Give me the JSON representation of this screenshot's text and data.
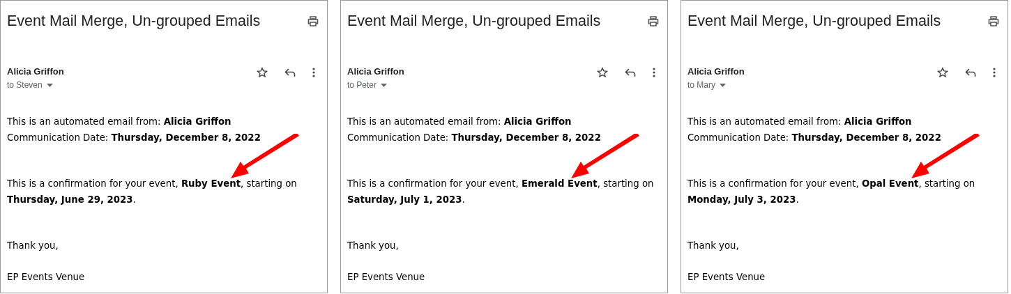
{
  "emails": [
    {
      "subject": "Event Mail Merge, Un-grouped Emails",
      "sender": "Alicia Griffon",
      "recipient": "to Steven",
      "body": [
        "This is an automated email from: **Alicia Griffon**",
        "Communication Date: **Thursday, December 8, 2022**",
        "This is a confirmation for your event, **Ruby Event**, starting on **Thursday, June 29, 2023**.",
        "Thank you,",
        "EP Events Venue"
      ]
    },
    {
      "subject": "Event Mail Merge, Un-grouped Emails",
      "sender": "Alicia Griffon",
      "recipient": "to Peter",
      "body": [
        "This is an automated email from: **Alicia Griffon**",
        "Communication Date: **Thursday, December 8, 2022**",
        "This is a confirmation for your event, **Emerald Event**, starting on **Saturday, July 1, 2023**.",
        "Thank you,",
        "EP Events Venue"
      ]
    },
    {
      "subject": "Event Mail Merge, Un-grouped Emails",
      "sender": "Alicia Griffon",
      "recipient": "to Mary",
      "body": [
        "This is an automated email from: **Alicia Griffon**",
        "Communication Date: **Thursday, December 8, 2022**",
        "This is a confirmation for your event, **Opal Event**, starting on **Monday, July 3, 2023**.",
        "Thank you,",
        "EP Events Venue"
      ]
    }
  ]
}
